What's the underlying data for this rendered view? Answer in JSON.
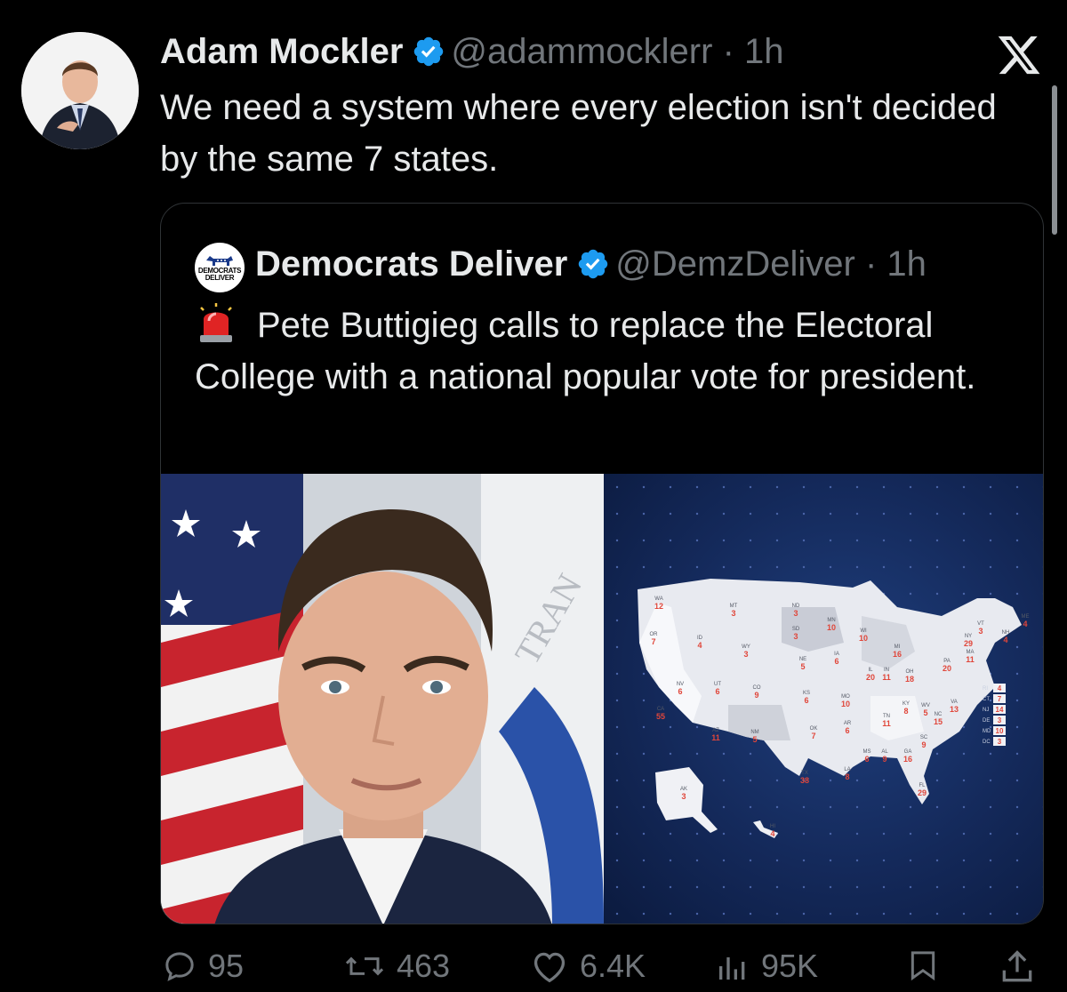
{
  "tweet": {
    "author_name": "Adam Mockler",
    "author_handle": "@adammocklerr",
    "time": "· 1h",
    "text": "We need a system where every election isn't decided by the same 7 states."
  },
  "quoted_tweet": {
    "author_name": "Democrats Deliver",
    "author_handle": "@DemzDeliver",
    "time": "· 1h",
    "avatar_text_line1": "DEMOCRATS",
    "avatar_text_line2": "DELIVER",
    "text": "Pete Buttigieg calls to replace the Electoral College with a national popular vote for president.",
    "media": {
      "photo_alt": "Pete Buttigieg official portrait",
      "map_alt": "Map of US states with electoral votes",
      "map_labels": [
        {
          "state": "WA",
          "votes": "12"
        },
        {
          "state": "MT",
          "votes": "3"
        },
        {
          "state": "ND",
          "votes": "3"
        },
        {
          "state": "MN",
          "votes": "10"
        },
        {
          "state": "WI",
          "votes": "10"
        },
        {
          "state": "MI",
          "votes": "16"
        },
        {
          "state": "NY",
          "votes": "29"
        },
        {
          "state": "VT",
          "votes": "3"
        },
        {
          "state": "ME",
          "votes": "4"
        },
        {
          "state": "OR",
          "votes": "7"
        },
        {
          "state": "ID",
          "votes": "4"
        },
        {
          "state": "WY",
          "votes": "3"
        },
        {
          "state": "SD",
          "votes": "3"
        },
        {
          "state": "IA",
          "votes": "6"
        },
        {
          "state": "NE",
          "votes": "5"
        },
        {
          "state": "IL",
          "votes": "20"
        },
        {
          "state": "IN",
          "votes": "11"
        },
        {
          "state": "OH",
          "votes": "18"
        },
        {
          "state": "PA",
          "votes": "20"
        },
        {
          "state": "NV",
          "votes": "6"
        },
        {
          "state": "UT",
          "votes": "6"
        },
        {
          "state": "CO",
          "votes": "9"
        },
        {
          "state": "KS",
          "votes": "6"
        },
        {
          "state": "MO",
          "votes": "10"
        },
        {
          "state": "KY",
          "votes": "8"
        },
        {
          "state": "WV",
          "votes": "5"
        },
        {
          "state": "VA",
          "votes": "13"
        },
        {
          "state": "CA",
          "votes": "55"
        },
        {
          "state": "AZ",
          "votes": "11"
        },
        {
          "state": "NM",
          "votes": "5"
        },
        {
          "state": "OK",
          "votes": "7"
        },
        {
          "state": "AR",
          "votes": "6"
        },
        {
          "state": "TN",
          "votes": "11"
        },
        {
          "state": "NC",
          "votes": "15"
        },
        {
          "state": "SC",
          "votes": "9"
        },
        {
          "state": "MS",
          "votes": "6"
        },
        {
          "state": "AL",
          "votes": "9"
        },
        {
          "state": "GA",
          "votes": "16"
        },
        {
          "state": "TX",
          "votes": "38"
        },
        {
          "state": "LA",
          "votes": "8"
        },
        {
          "state": "FL",
          "votes": "29"
        },
        {
          "state": "AK",
          "votes": "3"
        },
        {
          "state": "HI",
          "votes": "4"
        },
        {
          "state": "MA",
          "votes": "11"
        },
        {
          "state": "NH",
          "votes": "4"
        }
      ],
      "map_side_labels": [
        {
          "state": "RI",
          "votes": "4"
        },
        {
          "state": "CT",
          "votes": "7"
        },
        {
          "state": "NJ",
          "votes": "14"
        },
        {
          "state": "DE",
          "votes": "3"
        },
        {
          "state": "MD",
          "votes": "10"
        },
        {
          "state": "DC",
          "votes": "3"
        }
      ]
    }
  },
  "actions": {
    "replies": "95",
    "reposts": "463",
    "likes": "6.4K",
    "views": "95K"
  },
  "icons": {
    "reply": "reply-icon",
    "repost": "repost-icon",
    "like": "like-icon",
    "views": "views-icon",
    "bookmark": "bookmark-icon",
    "share": "share-icon",
    "verified": "verified-badge-icon",
    "x": "x-logo-icon",
    "siren": "rotating-light-emoji"
  },
  "colors": {
    "background": "#000000",
    "text": "#e7e9ea",
    "muted": "#71767b",
    "verified": "#1d9bf0",
    "map_votes": "#e0463a"
  }
}
